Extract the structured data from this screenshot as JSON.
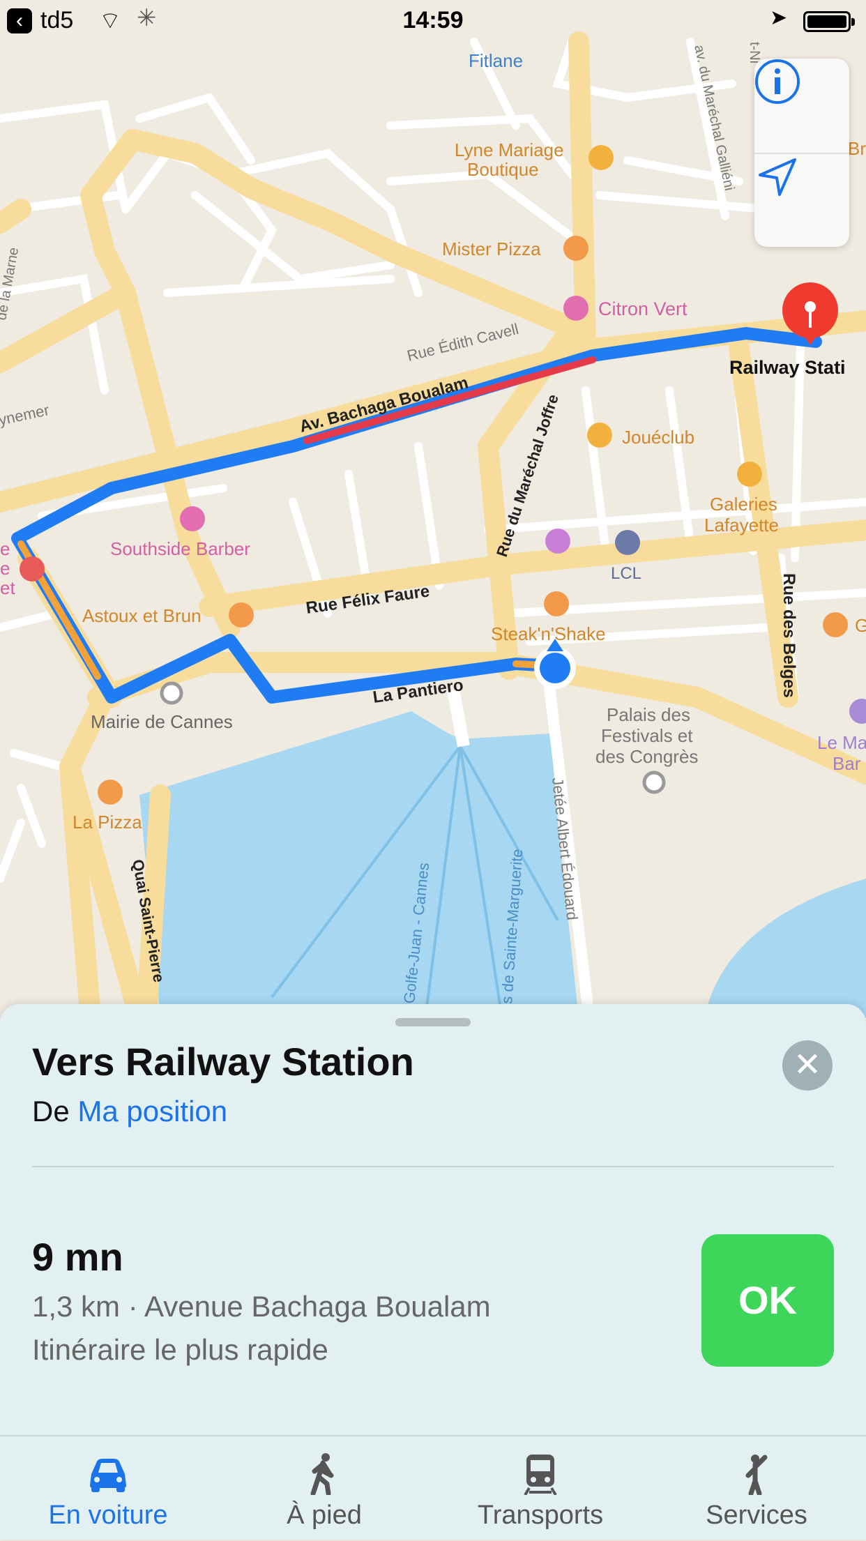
{
  "status_bar": {
    "back_glyph": "‹",
    "carrier": "td5",
    "wifi_glyph": "⌔",
    "spinner_glyph": "✳",
    "time": "14:59",
    "location_glyph": "➤"
  },
  "map": {
    "labels": {
      "fitlane": "Fitlane",
      "lyne_1": "Lyne Mariage",
      "lyne_2": "Boutique",
      "mister_pizza": "Mister Pizza",
      "citron_vert": "Citron Vert",
      "rue_edith": "Rue Édith Cavell",
      "railway": "Railway Stati",
      "bachaga": "Av. Bachaga Boualam",
      "joffre": "Rue du Maréchal Joffre",
      "joueclub": "Jouéclub",
      "galeries_1": "Galeries",
      "galeries_2": "Lafayette",
      "southside": "Southside Barber",
      "lcl": "LCL",
      "felix_faure": "Rue Félix Faure",
      "astoux": "Astoux et Brun",
      "steak": "Steak'n'Shake",
      "belges": "Rue des Belges",
      "pantiero": "La Pantiero",
      "mairie": "Mairie de Cannes",
      "palais_1": "Palais des",
      "palais_2": "Festivals et",
      "palais_3": "des Congrès",
      "la_pizza": "La Pizza",
      "quai": "Quai Saint-Pierre",
      "golfe": "Golfe-Juan - Cannes",
      "sainte": "s de Sainte-Marguerite",
      "jetee": "Jetée Albert Édouard",
      "galliéni": "av. du Maréchal Galliéni",
      "marne": "de la Marne",
      "ynemer": "ynemer",
      "le_ma_1": "Le Ma",
      "le_ma_2": "Bar",
      "br": "Br",
      "g": "G",
      "e_left": "e",
      "e_left2": "e",
      "et_left": "et",
      "tni": "t-Ni"
    }
  },
  "colors": {
    "route": "#1f7cf2",
    "traffic_red": "#e53a4a",
    "traffic_orange": "#f3a23a",
    "water": "#a7d7f1",
    "ok_green": "#3dd55a",
    "accent_blue": "#1a73e8",
    "pin_red": "#f03a2f"
  },
  "sheet": {
    "title": "Vers Railway Station",
    "from_prefix": "De",
    "from_link": "Ma position",
    "close_glyph": "✕",
    "duration": "9 mn",
    "details": "1,3 km · Avenue Bachaga Boualam",
    "route_type": "Itinéraire le plus rapide",
    "ok_label": "OK"
  },
  "tabs": [
    {
      "label": "En voiture",
      "icon": "car-icon",
      "active": true
    },
    {
      "label": "À pied",
      "icon": "walking-icon",
      "active": false
    },
    {
      "label": "Transports",
      "icon": "train-icon",
      "active": false
    },
    {
      "label": "Services",
      "icon": "taxi-hail-icon",
      "active": false
    }
  ]
}
